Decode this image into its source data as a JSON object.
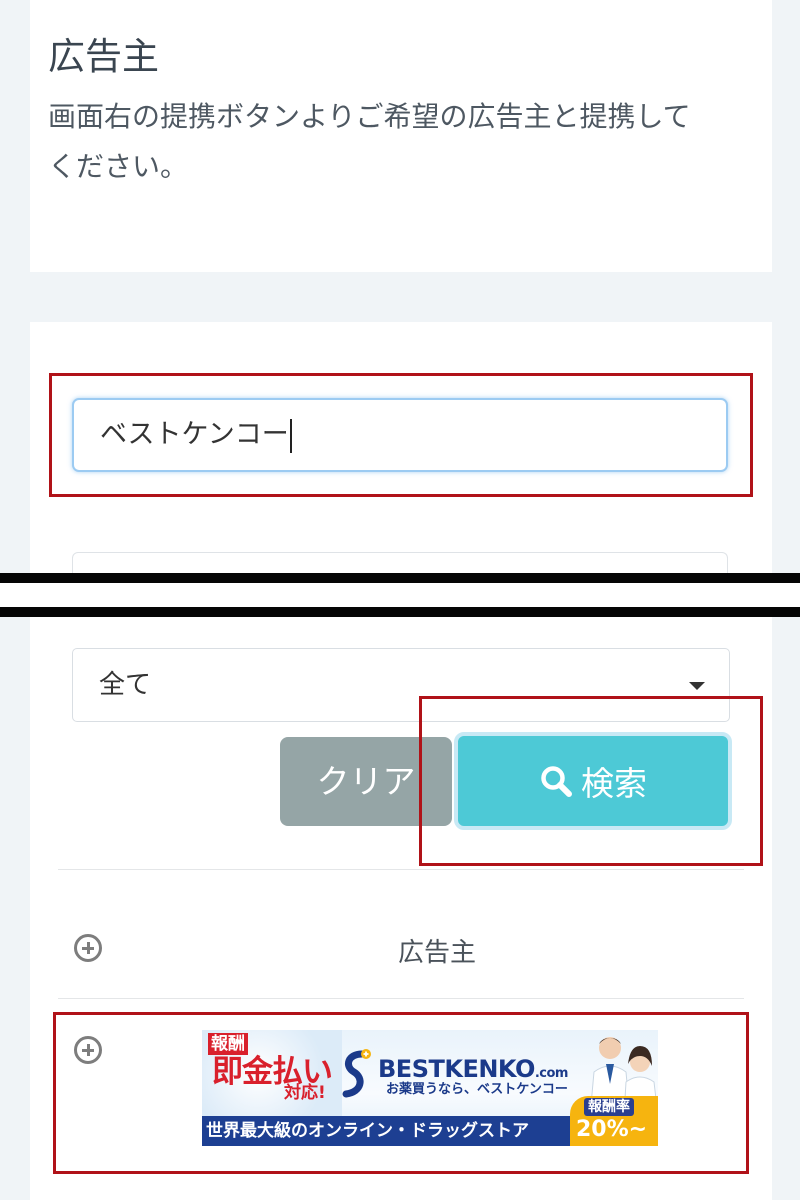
{
  "header": {
    "title": "広告主",
    "description": "画面右の提携ボタンよりご希望の広告主と提携してください。"
  },
  "search": {
    "keyword_value": "ベストケンコー",
    "category_value": "全て",
    "clear_label": "クリア",
    "search_label": "検索"
  },
  "table": {
    "column_header": "広告主",
    "rows": [
      {
        "banner": {
          "tag": "報酬",
          "headline": "即金払い",
          "headline_sub": "対応!",
          "brand": "BESTKENKO",
          "brand_suffix": ".com",
          "tagline": "お薬買うなら、ベストケンコー",
          "bottom_text": "世界最大級のオンライン・ドラッグストア",
          "rate_label": "報酬率",
          "rate_value": "20%~"
        }
      }
    ]
  },
  "colors": {
    "search_button": "#4dc9d6",
    "clear_button": "#95a5a6",
    "annotation": "#b01218"
  }
}
